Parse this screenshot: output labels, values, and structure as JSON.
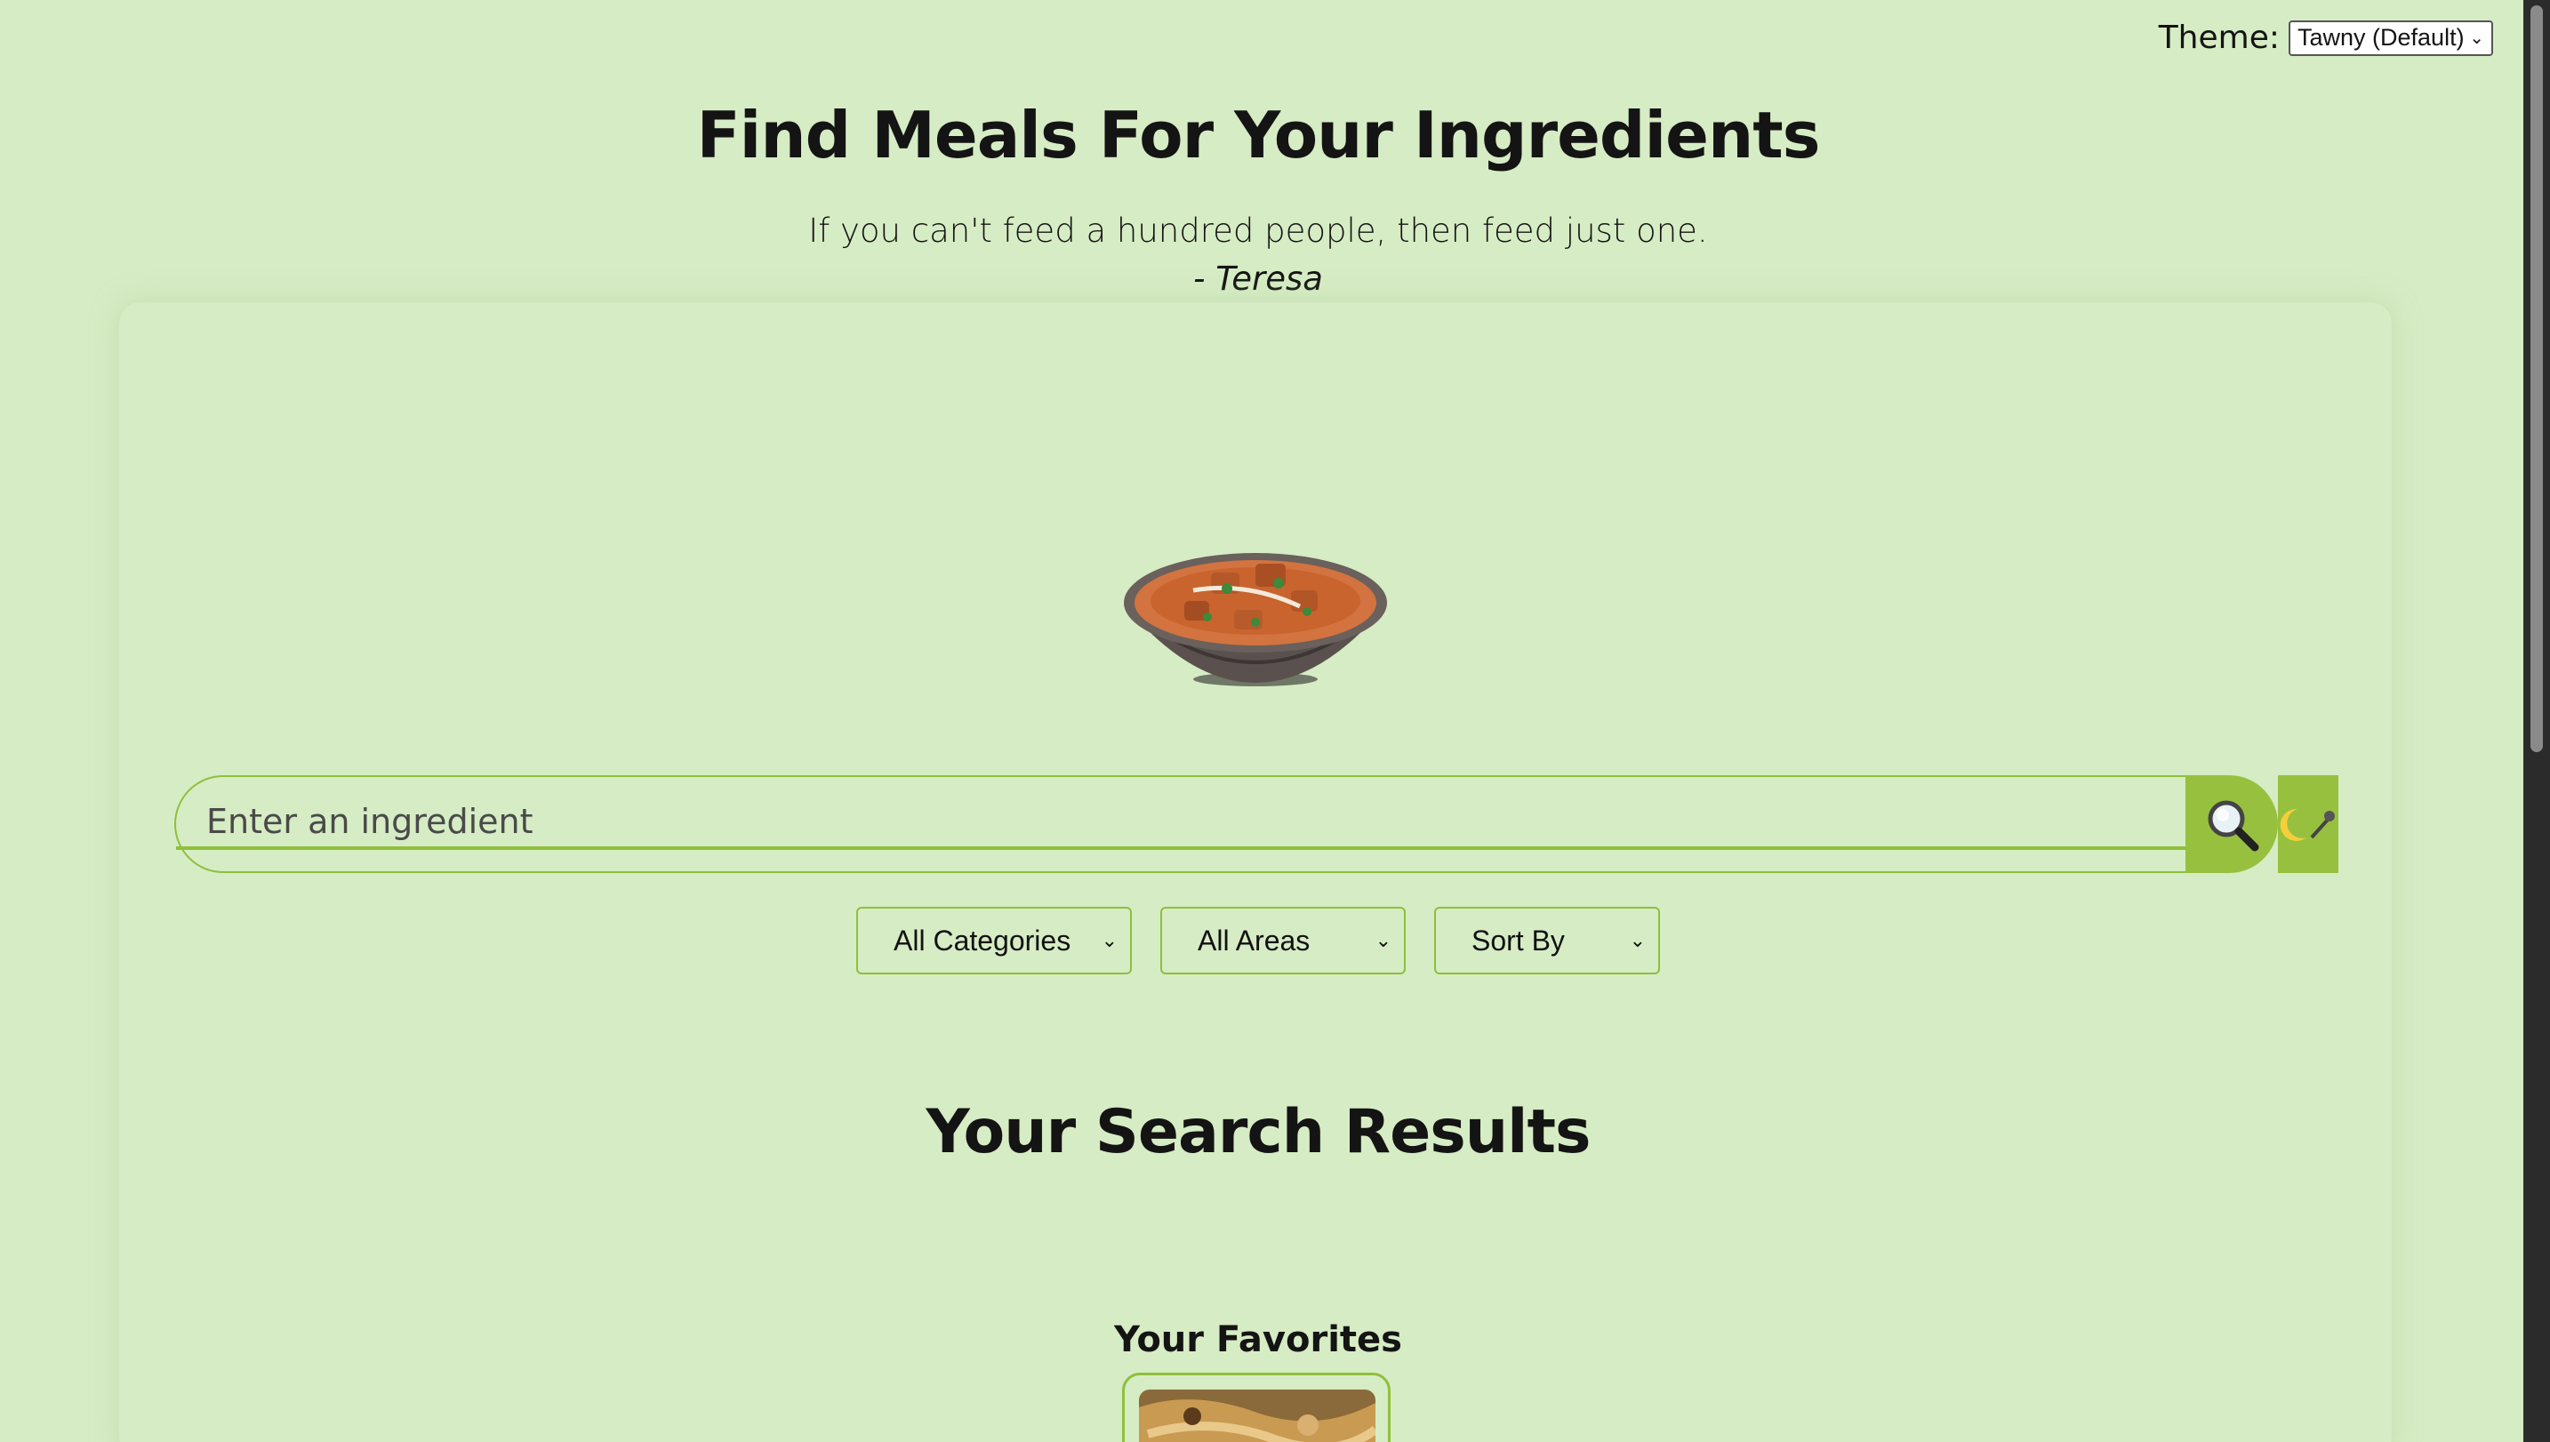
{
  "theme": {
    "label": "Theme:",
    "selected": "Tawny (Default)"
  },
  "header": {
    "title": "Find Meals For Your Ingredients",
    "quote": "If you can't feed a hundred people, then feed just one.",
    "quote_author": "- Teresa"
  },
  "search": {
    "placeholder": "Enter an ingredient",
    "search_icon": "magnifier-icon",
    "voice_icons": [
      "moon-icon",
      "microphone-icon"
    ]
  },
  "filters": {
    "category": "All Categories",
    "area": "All Areas",
    "sort": "Sort By"
  },
  "results": {
    "title": "Your Search Results"
  },
  "favorites": {
    "title": "Your Favorites"
  },
  "colors": {
    "background": "#d6ecc4",
    "accent": "#97c03f",
    "border": "#8fbf3c",
    "text": "#141414"
  }
}
